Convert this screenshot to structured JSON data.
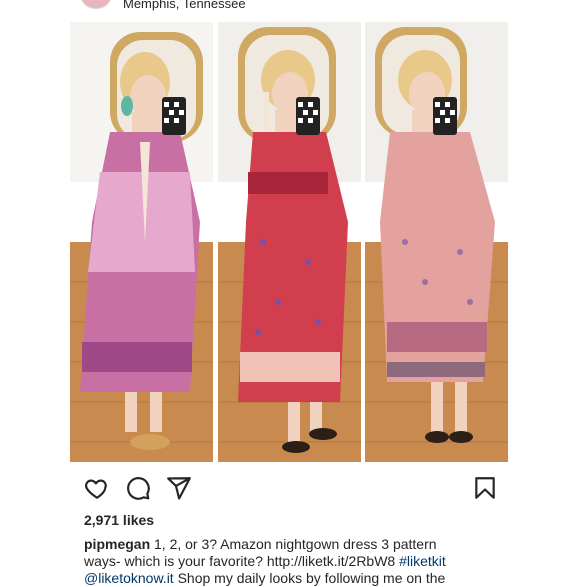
{
  "post": {
    "location": "Memphis, Tennessee",
    "likes": "2,971 likes",
    "username": "pipmegan",
    "caption_line1_text": " 1, 2, or 3? Amazon nightgown dress 3 pattern",
    "caption_line2_text": "ways- which is your favorite? http://liketk.it/2RbW8 ",
    "hashtag": "#liketkit",
    "mention": "@liketoknow.it",
    "caption_line3_text": " Shop my daily looks by following me on the"
  },
  "icons": {
    "like": "heart-icon",
    "comment": "comment-icon",
    "share": "send-icon",
    "save": "bookmark-icon"
  },
  "colors": {
    "link": "#00376b",
    "text": "#262626",
    "dress1": "#c86fa4",
    "dress2": "#d13f4f",
    "dress3": "#e3a29d"
  }
}
